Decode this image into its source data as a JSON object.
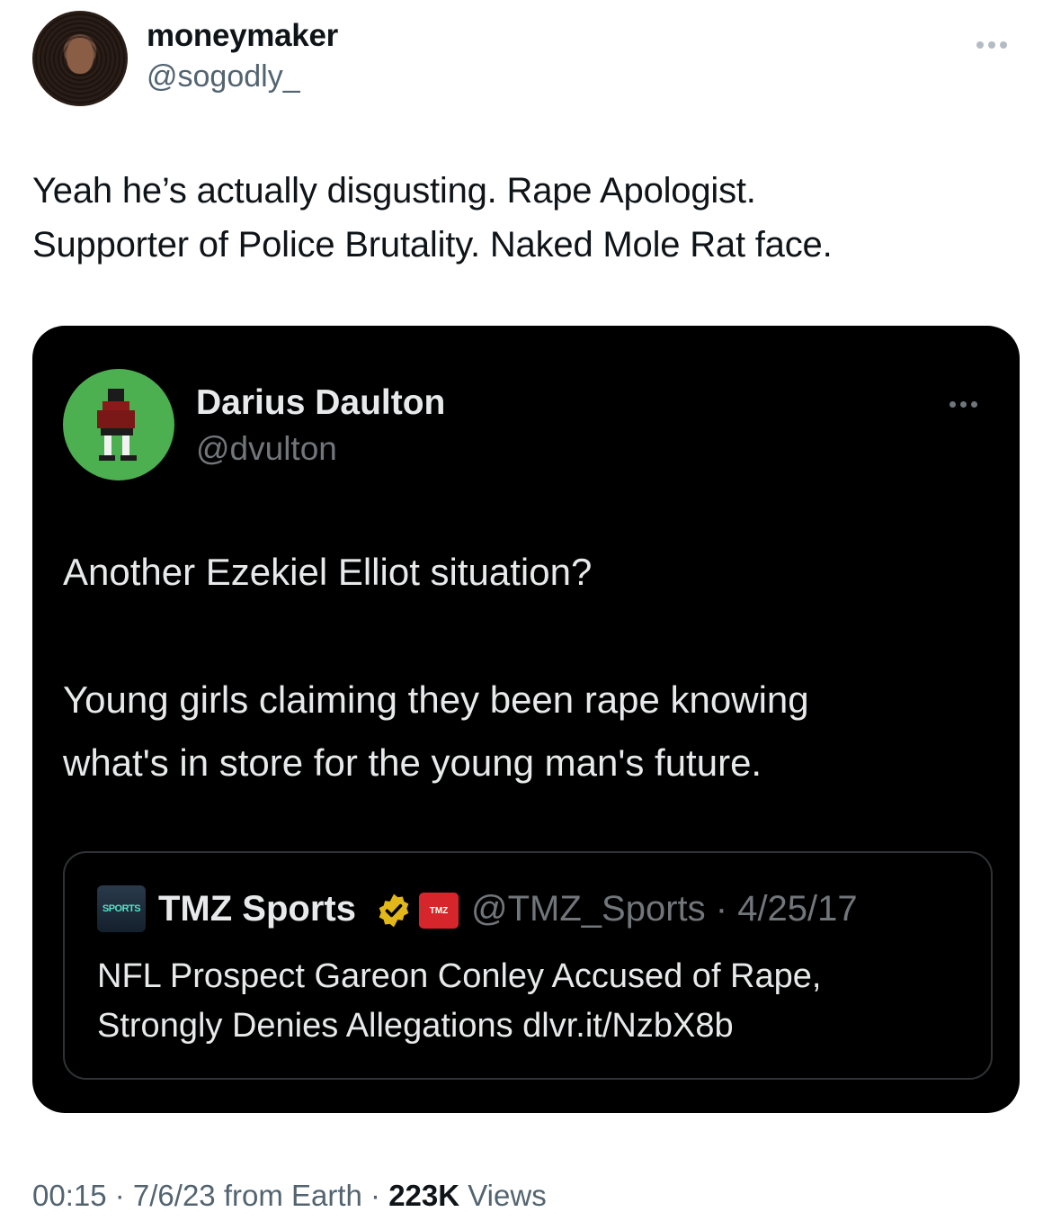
{
  "author": {
    "name": "moneymaker",
    "handle": "@sogodly_"
  },
  "tweet": {
    "lines": [
      "Yeah he’s actually disgusting. Rape Apologist.",
      "Supporter of Police Brutality. Naked Mole Rat face."
    ]
  },
  "embedded": {
    "name": "Darius Daulton",
    "handle": "@dvulton",
    "text_line1": "Another Ezekiel Elliot situation?",
    "text_line2": "Young girls claiming they been rape knowing",
    "text_line3": "what's in store for the young man's future.",
    "quote": {
      "logo_text": "SPORTS",
      "name": "TMZ Sports",
      "tmz_text": "TMZ",
      "handle_date": "@TMZ_Sports · 4/25/17",
      "lines": [
        "NFL Prospect Gareon Conley Accused of Rape,",
        "Strongly Denies Allegations dlvr.it/NzbX8b"
      ]
    }
  },
  "footer": {
    "time_date": "00:15 · 7/6/23 from Earth · ",
    "views_count": "223K",
    "views_label": " Views"
  },
  "colors": {
    "verified_badge": "#e2b719",
    "tmz_red": "#d7262b",
    "embed_bg": "#000000"
  }
}
